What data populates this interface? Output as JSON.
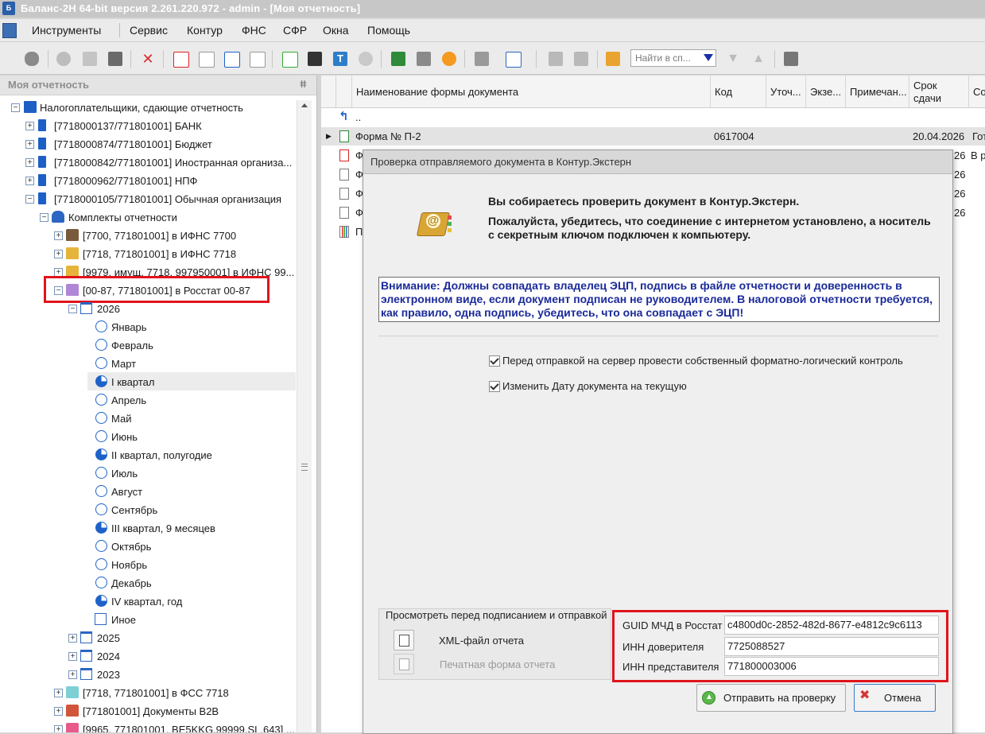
{
  "window": {
    "title": "Баланс-2Н 64-bit версия 2.261.220.972 - admin - [Моя отчетность]"
  },
  "menu": [
    "Инструменты",
    "Сервис",
    "Контур",
    "ФНС",
    "СФР",
    "Окна",
    "Помощь"
  ],
  "toolbar": {
    "search_placeholder": "Найти в сп..."
  },
  "left_panel": {
    "title": "Моя отчетность",
    "tree": {
      "root": "Налогоплательщики, сдающие отчетность",
      "orgs": [
        "[7718000137/771801001] БАНК",
        "[7718000874/771801001] Бюджет",
        "[7718000842/771801001] Иностранная организа...",
        "[7718000962/771801001] НПФ",
        "[7718000105/771801001] Обычная организация"
      ],
      "sets_label": "Комплекты отчетности",
      "sets_top": [
        "[7700, 771801001] в ИФНС 7700",
        "[7718, 771801001] в ИФНС 7718",
        "[9979, имущ. 7718, 997950001] в ИФНС 99..."
      ],
      "selected_set": "[00-87, 771801001] в Росстат 00-87",
      "year": "2026",
      "periods": [
        "Январь",
        "Февраль",
        "Март",
        "I квартал",
        "Апрель",
        "Май",
        "Июнь",
        "II квартал, полугодие",
        "Июль",
        "Август",
        "Сентябрь",
        "III квартал, 9 месяцев",
        "Октябрь",
        "Ноябрь",
        "Декабрь",
        "IV квартал, год",
        "Иное"
      ],
      "years_other": [
        "2025",
        "2024",
        "2023"
      ],
      "sets_bottom": [
        "[7718, 771801001] в ФСС 7718",
        "[771801001] Документы B2B",
        "[9965, 771801001, BE5KKG.99999.SL.643] ..."
      ]
    }
  },
  "grid": {
    "headers": [
      "Наименование формы документа",
      "Код",
      "Уточ...",
      "Экзе...",
      "Примечан...",
      "Срок сдачи",
      "Со"
    ],
    "up_row": "..",
    "rows": [
      {
        "name": "Форма № П-2",
        "code": "0617004",
        "due": "20.04.2026",
        "status": "Гот"
      },
      {
        "name": "Ф",
        "due": "26",
        "status": "В р"
      },
      {
        "name": "Ф",
        "due": "26",
        "status": ""
      },
      {
        "name": "Ф",
        "due": "26",
        "status": ""
      },
      {
        "name": "Ф",
        "due": "26",
        "status": ""
      },
      {
        "name": "П",
        "due": "",
        "status": ""
      }
    ]
  },
  "dialog": {
    "title": "Проверка отправляемого документа в Контур.Экстерн",
    "msg1": "Вы собираетесь проверить документ в Контур.Экстерн.",
    "msg2": "Пожалуйста, убедитесь, что соединение с интернетом установлено, а носитель с секретным ключом подключен к компьютеру.",
    "warning": "Внимание: Должны совпадать владелец ЭЦП, подпись в файле отчетности и доверенность в электронном виде, если документ подписан не руководителем. В налоговой отчетности требуется, как правило, одна подпись, убедитесь, что она совпадает с ЭЦП!",
    "check1": "Перед отправкой на сервер провести собственный форматно-логический контроль",
    "check2": "Изменить Дату документа на текущую",
    "preview_group": "Просмотреть перед подписанием и отправкой",
    "xml_label": "XML-файл отчета",
    "print_label": "Печатная форма отчета",
    "guid_label": "GUID МЧД в Росстат",
    "guid_value": "c4800d0c-2852-482d-8677-e4812c9c6113",
    "inn_principal_label": "ИНН доверителя",
    "inn_principal_value": "7725088527",
    "inn_rep_label": "ИНН представителя",
    "inn_rep_value": "771800003006",
    "send_button": "Отправить на проверку",
    "cancel_button": "Отмена"
  }
}
